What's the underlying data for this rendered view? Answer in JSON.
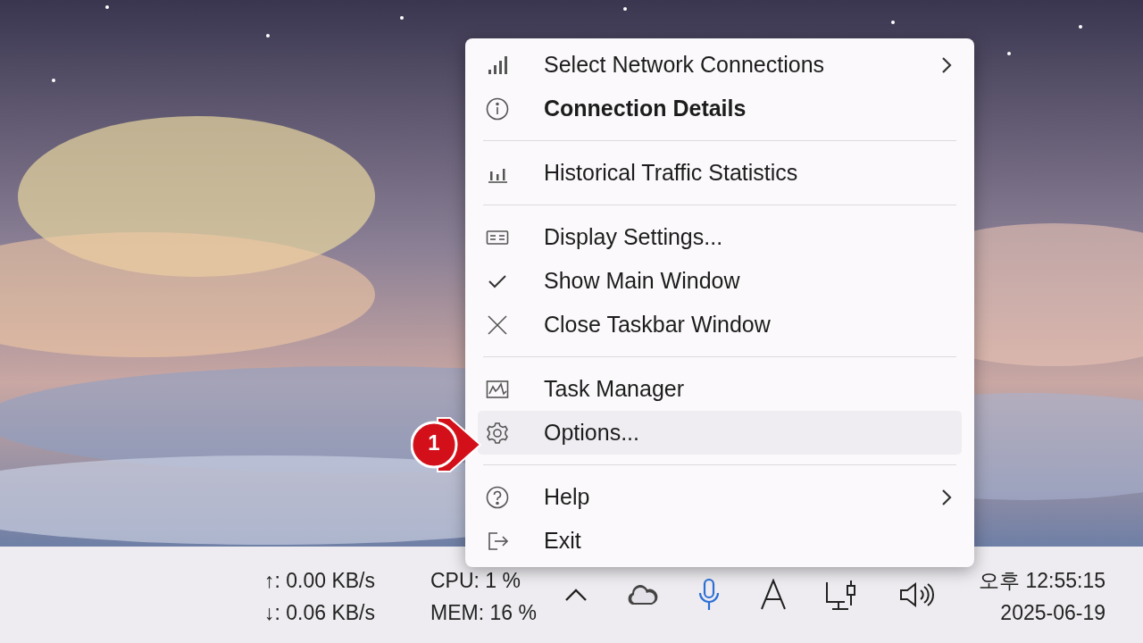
{
  "menu": {
    "items": [
      {
        "kind": "item",
        "label": "Select Network Connections",
        "bold": false,
        "checked": false,
        "submenu": true,
        "selected": false
      },
      {
        "kind": "item",
        "label": "Connection Details",
        "bold": true,
        "checked": false,
        "submenu": false,
        "selected": false
      },
      {
        "kind": "separator"
      },
      {
        "kind": "item",
        "label": "Historical Traffic Statistics",
        "bold": false,
        "checked": false,
        "submenu": false,
        "selected": false
      },
      {
        "kind": "separator"
      },
      {
        "kind": "item",
        "label": "Display Settings...",
        "bold": false,
        "checked": false,
        "submenu": false,
        "selected": false
      },
      {
        "kind": "item",
        "label": "Show Main Window",
        "bold": false,
        "checked": true,
        "submenu": false,
        "selected": false
      },
      {
        "kind": "item",
        "label": "Close Taskbar Window",
        "bold": false,
        "checked": false,
        "submenu": false,
        "selected": false
      },
      {
        "kind": "separator"
      },
      {
        "kind": "item",
        "label": "Task Manager",
        "bold": false,
        "checked": false,
        "submenu": false,
        "selected": false
      },
      {
        "kind": "item",
        "label": "Options...",
        "bold": false,
        "checked": false,
        "submenu": false,
        "selected": true
      },
      {
        "kind": "separator"
      },
      {
        "kind": "item",
        "label": "Help",
        "bold": false,
        "checked": false,
        "submenu": true,
        "selected": false
      },
      {
        "kind": "item",
        "label": "Exit",
        "bold": false,
        "checked": false,
        "submenu": false,
        "selected": false
      }
    ]
  },
  "callout": {
    "label": "1"
  },
  "taskbar": {
    "upload": "↑: 0.00 KB/s",
    "download": "↓: 0.06 KB/s",
    "cpu": "CPU: 1 %",
    "mem": "MEM: 16 %",
    "time": "오후 12:55:15",
    "date": "2025-06-19"
  }
}
